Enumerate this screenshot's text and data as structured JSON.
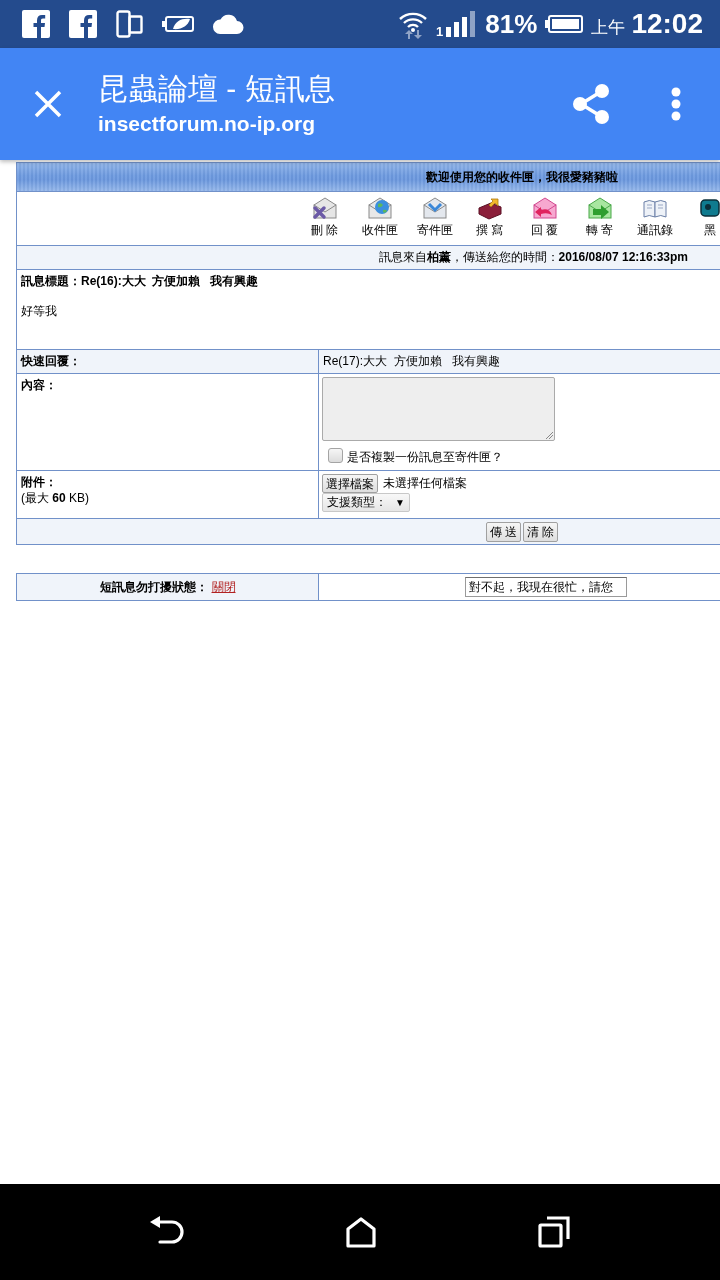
{
  "status_bar": {
    "sim_slot": "1",
    "battery": "81%",
    "time_period": "上午",
    "time": "12:02"
  },
  "app_bar": {
    "title": "昆蟲論壇 - 短訊息",
    "url": "insectforum.no-ip.org"
  },
  "inbox": {
    "banner": "歡迎使用您的收件匣，我很愛豬豬啦",
    "toolbar": [
      {
        "kind": "delete",
        "label": "刪 除"
      },
      {
        "kind": "inbox",
        "label": "收件匣"
      },
      {
        "kind": "outbox",
        "label": "寄件匣"
      },
      {
        "kind": "compose",
        "label": "撰 寫"
      },
      {
        "kind": "reply",
        "label": "回 覆"
      },
      {
        "kind": "forward",
        "label": "轉 寄"
      },
      {
        "kind": "contacts",
        "label": "通訊錄"
      },
      {
        "kind": "blacklist",
        "label": "黑"
      }
    ],
    "sender_line": "訊息來自**柏薰**，傳送給您的時間：**2016/08/07 12:16:33pm**",
    "subject": "訊息標題：Re(16):大大  方便加賴   我有興趣",
    "body": "好等我"
  },
  "quick_reply": {
    "label": "快速回覆：",
    "subject": "Re(17):大大  方便加賴   我有興趣",
    "content_label": "內容：",
    "copy_to_outbox": {
      "label": "是否複製一份訊息至寄件匣？",
      "checked": false
    },
    "attachment_label": "附件：",
    "attachment_limit": "(最大 **60** KB)",
    "choose_file_button": "選擇檔案",
    "file_status": "未選擇任何檔案",
    "type_select": {
      "value": "支援類型：",
      "arrow": "▼"
    },
    "buttons": [
      "傳 送",
      "清 除"
    ]
  },
  "dnd": {
    "label": "短訊息勿打擾狀態：",
    "status": "關閉",
    "message": "對不起，我現在很忙，請您"
  }
}
